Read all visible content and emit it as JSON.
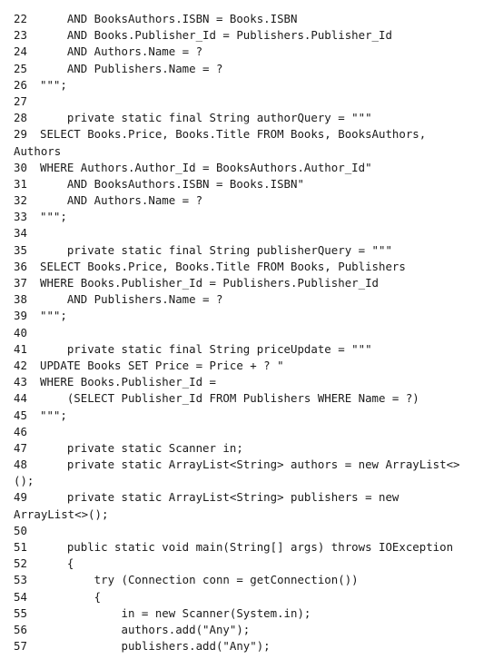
{
  "lines": [
    {
      "n": "22",
      "text": "    AND BooksAuthors.ISBN = Books.ISBN"
    },
    {
      "n": "23",
      "text": "    AND Books.Publisher_Id = Publishers.Publisher_Id"
    },
    {
      "n": "24",
      "text": "    AND Authors.Name = ?"
    },
    {
      "n": "25",
      "text": "    AND Publishers.Name = ?"
    },
    {
      "n": "26",
      "text": "\"\"\";"
    },
    {
      "n": "27",
      "text": ""
    },
    {
      "n": "28",
      "text": "    private static final String authorQuery = \"\"\""
    },
    {
      "n": "29",
      "text": "SELECT Books.Price, Books.Title FROM Books, BooksAuthors,"
    },
    {
      "n": "",
      "text": "Authors",
      "wrap": true
    },
    {
      "n": "30",
      "text": "WHERE Authors.Author_Id = BooksAuthors.Author_Id\""
    },
    {
      "n": "31",
      "text": "    AND BooksAuthors.ISBN = Books.ISBN\""
    },
    {
      "n": "32",
      "text": "    AND Authors.Name = ?"
    },
    {
      "n": "33",
      "text": "\"\"\";"
    },
    {
      "n": "34",
      "text": ""
    },
    {
      "n": "35",
      "text": "    private static final String publisherQuery = \"\"\""
    },
    {
      "n": "36",
      "text": "SELECT Books.Price, Books.Title FROM Books, Publishers"
    },
    {
      "n": "37",
      "text": "WHERE Books.Publisher_Id = Publishers.Publisher_Id"
    },
    {
      "n": "38",
      "text": "    AND Publishers.Name = ?"
    },
    {
      "n": "39",
      "text": "\"\"\";"
    },
    {
      "n": "40",
      "text": ""
    },
    {
      "n": "41",
      "text": "    private static final String priceUpdate = \"\"\""
    },
    {
      "n": "42",
      "text": "UPDATE Books SET Price = Price + ? \""
    },
    {
      "n": "43",
      "text": "WHERE Books.Publisher_Id ="
    },
    {
      "n": "44",
      "text": "    (SELECT Publisher_Id FROM Publishers WHERE Name = ?)"
    },
    {
      "n": "45",
      "text": "\"\"\";"
    },
    {
      "n": "46",
      "text": ""
    },
    {
      "n": "47",
      "text": "    private static Scanner in;"
    },
    {
      "n": "48",
      "text": "    private static ArrayList<String> authors = new ArrayList<>"
    },
    {
      "n": "",
      "text": "();",
      "wrap": true
    },
    {
      "n": "49",
      "text": "    private static ArrayList<String> publishers = new"
    },
    {
      "n": "",
      "text": "ArrayList<>();",
      "wrap": true
    },
    {
      "n": "50",
      "text": ""
    },
    {
      "n": "51",
      "text": "    public static void main(String[] args) throws IOException"
    },
    {
      "n": "52",
      "text": "    {"
    },
    {
      "n": "53",
      "text": "        try (Connection conn = getConnection())"
    },
    {
      "n": "54",
      "text": "        {"
    },
    {
      "n": "55",
      "text": "            in = new Scanner(System.in);"
    },
    {
      "n": "56",
      "text": "            authors.add(\"Any\");"
    },
    {
      "n": "57",
      "text": "            publishers.add(\"Any\");"
    }
  ]
}
